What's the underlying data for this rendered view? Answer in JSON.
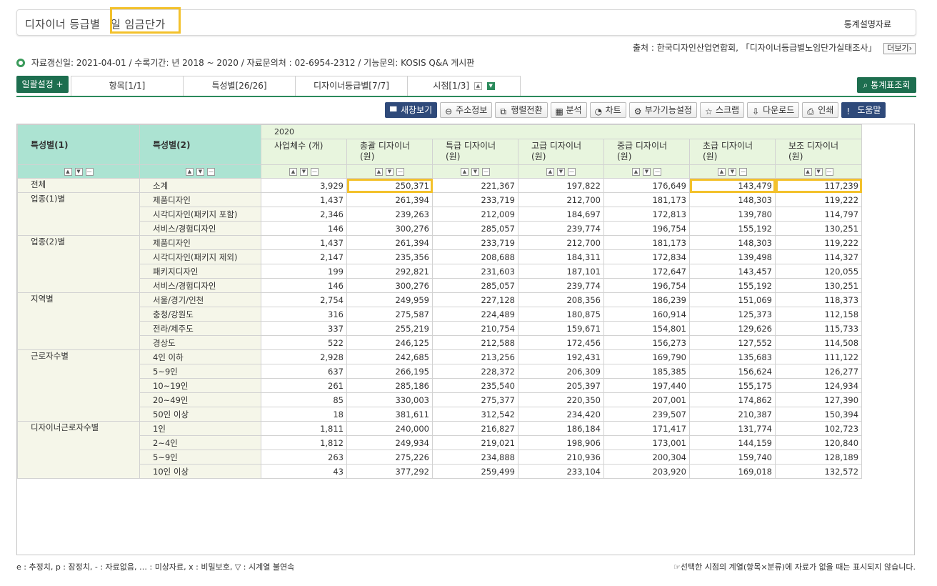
{
  "header": {
    "title_prefix": "디자이너 등급별",
    "title_suffix": "일 임금단가",
    "right_link": "통계설명자료"
  },
  "source": {
    "text": "출처 : 한국디자인산업연합회, 「디자이너등급별노임단가실태조사」",
    "more": "더보기›"
  },
  "info": {
    "text": "자료갱신일: 2021-04-01 / 수록기간: 년 2018 ~ 2020 / 자료문의처 : 02-6954-2312 / 기능문의: KOSIS Q&A 게시판"
  },
  "settings": {
    "batch_label": "일괄설정 +",
    "tabs": [
      "항목[1/1]",
      "특성별[26/26]",
      "디자이너등급별[7/7]",
      "시점[1/3]"
    ],
    "stat_button": "통계표조회"
  },
  "toolbar": {
    "buttons": [
      {
        "label": "새창보기",
        "icon": "new-window-icon"
      },
      {
        "label": "주소정보",
        "icon": "link-icon"
      },
      {
        "label": "행렬전환",
        "icon": "swap-icon"
      },
      {
        "label": "분석",
        "icon": "analysis-icon"
      },
      {
        "label": "차트",
        "icon": "chart-icon"
      },
      {
        "label": "부가기능설정",
        "icon": "gear-icon"
      },
      {
        "label": "스크랩",
        "icon": "star-icon"
      },
      {
        "label": "다운로드",
        "icon": "download-icon"
      },
      {
        "label": "인쇄",
        "icon": "print-icon"
      },
      {
        "label": "도움말",
        "icon": "help-icon"
      }
    ]
  },
  "table": {
    "char1_header": "특성별(1)",
    "char2_header": "특성별(2)",
    "year": "2020",
    "columns": [
      "사업체수 (개)",
      "총괄 디자이너 (원)",
      "특급 디자이너 (원)",
      "고급 디자이너 (원)",
      "중급 디자이너 (원)",
      "초급 디자이너 (원)",
      "보조 디자이너 (원)"
    ],
    "groups": [
      {
        "name": "전체",
        "rows": [
          {
            "label": "소계",
            "values": [
              "3,929",
              "250,371",
              "221,367",
              "197,822",
              "176,649",
              "143,479",
              "117,239"
            ]
          }
        ]
      },
      {
        "name": "업종(1)별",
        "rows": [
          {
            "label": "제품디자인",
            "values": [
              "1,437",
              "261,394",
              "233,719",
              "212,700",
              "181,173",
              "148,303",
              "119,222"
            ]
          },
          {
            "label": "시각디자인(패키지 포함)",
            "values": [
              "2,346",
              "239,263",
              "212,009",
              "184,697",
              "172,813",
              "139,780",
              "114,797"
            ]
          },
          {
            "label": "서비스/경험디자인",
            "values": [
              "146",
              "300,276",
              "285,057",
              "239,774",
              "196,754",
              "155,192",
              "130,251"
            ]
          }
        ]
      },
      {
        "name": "업종(2)별",
        "rows": [
          {
            "label": "제품디자인",
            "values": [
              "1,437",
              "261,394",
              "233,719",
              "212,700",
              "181,173",
              "148,303",
              "119,222"
            ]
          },
          {
            "label": "시각디자인(패키지 제외)",
            "values": [
              "2,147",
              "235,356",
              "208,688",
              "184,311",
              "172,834",
              "139,498",
              "114,327"
            ]
          },
          {
            "label": "패키지디자인",
            "values": [
              "199",
              "292,821",
              "231,603",
              "187,101",
              "172,647",
              "143,457",
              "120,055"
            ]
          },
          {
            "label": "서비스/경험디자인",
            "values": [
              "146",
              "300,276",
              "285,057",
              "239,774",
              "196,754",
              "155,192",
              "130,251"
            ]
          }
        ]
      },
      {
        "name": "지역별",
        "rows": [
          {
            "label": "서울/경기/인천",
            "values": [
              "2,754",
              "249,959",
              "227,128",
              "208,356",
              "186,239",
              "151,069",
              "118,373"
            ]
          },
          {
            "label": "충청/강원도",
            "values": [
              "316",
              "275,587",
              "224,489",
              "180,875",
              "160,914",
              "125,373",
              "112,158"
            ]
          },
          {
            "label": "전라/제주도",
            "values": [
              "337",
              "255,219",
              "210,754",
              "159,671",
              "154,801",
              "129,626",
              "115,733"
            ]
          },
          {
            "label": "경상도",
            "values": [
              "522",
              "246,125",
              "212,588",
              "172,456",
              "156,273",
              "127,552",
              "114,508"
            ]
          }
        ]
      },
      {
        "name": "근로자수별",
        "rows": [
          {
            "label": "4인 이하",
            "values": [
              "2,928",
              "242,685",
              "213,256",
              "192,431",
              "169,790",
              "135,683",
              "111,122"
            ]
          },
          {
            "label": "5~9인",
            "values": [
              "637",
              "266,195",
              "228,372",
              "206,309",
              "185,385",
              "156,624",
              "126,277"
            ]
          },
          {
            "label": "10~19인",
            "values": [
              "261",
              "285,186",
              "235,540",
              "205,397",
              "197,440",
              "155,175",
              "124,934"
            ]
          },
          {
            "label": "20~49인",
            "values": [
              "85",
              "330,003",
              "275,377",
              "220,350",
              "207,001",
              "174,862",
              "127,390"
            ]
          },
          {
            "label": "50인 이상",
            "values": [
              "18",
              "381,611",
              "312,542",
              "234,420",
              "239,507",
              "210,387",
              "150,394"
            ]
          }
        ]
      },
      {
        "name": "디자이너근로자수별",
        "rows": [
          {
            "label": "1인",
            "values": [
              "1,811",
              "240,000",
              "216,827",
              "186,184",
              "171,417",
              "131,774",
              "102,723"
            ]
          },
          {
            "label": "2~4인",
            "values": [
              "1,812",
              "249,934",
              "219,021",
              "198,906",
              "173,001",
              "144,159",
              "120,840"
            ]
          },
          {
            "label": "5~9인",
            "values": [
              "263",
              "275,226",
              "234,888",
              "210,936",
              "200,304",
              "159,740",
              "128,189"
            ]
          },
          {
            "label": "10인 이상",
            "values": [
              "43",
              "377,292",
              "259,499",
              "233,104",
              "203,920",
              "169,018",
              "132,572"
            ]
          }
        ]
      }
    ],
    "highlighted_cells": [
      "0-1",
      "0-5",
      "0-6"
    ]
  },
  "footer": {
    "legend": "e : 추정치, p : 잠정치, - : 자료없음, … : 미상자료, x : 비밀보호, ▽ : 시계열 불연속",
    "note": "☞선택한 시점의 계열(항목×분류)에 자료가 없을 때는 표시되지 않습니다."
  }
}
